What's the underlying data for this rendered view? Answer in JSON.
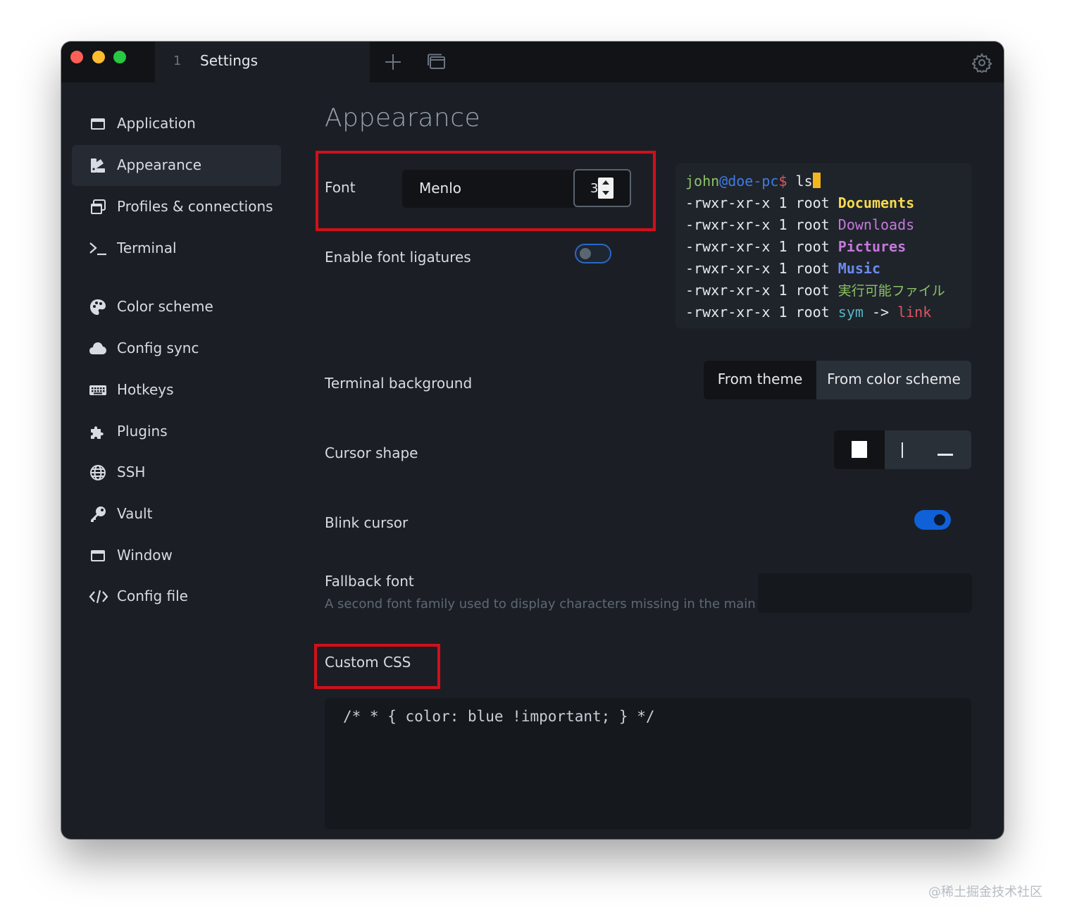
{
  "tab": {
    "number": "1",
    "title": "Settings"
  },
  "sidebar": {
    "items": [
      {
        "label": "Application",
        "icon": "application-icon"
      },
      {
        "label": "Appearance",
        "icon": "appearance-icon",
        "active": true
      },
      {
        "label": "Profiles & connections",
        "icon": "profiles-icon"
      },
      {
        "label": "Terminal",
        "icon": "terminal-icon"
      },
      {
        "label": "Color scheme",
        "icon": "palette-icon"
      },
      {
        "label": "Config sync",
        "icon": "cloud-icon"
      },
      {
        "label": "Hotkeys",
        "icon": "keyboard-icon"
      },
      {
        "label": "Plugins",
        "icon": "puzzle-icon"
      },
      {
        "label": "SSH",
        "icon": "globe-icon"
      },
      {
        "label": "Vault",
        "icon": "key-icon"
      },
      {
        "label": "Window",
        "icon": "window-icon"
      },
      {
        "label": "Config file",
        "icon": "code-icon"
      }
    ]
  },
  "main": {
    "title": "Appearance",
    "font": {
      "label": "Font",
      "value": "Menlo",
      "size": "3"
    },
    "ligatures": {
      "label": "Enable font ligatures",
      "enabled": false
    },
    "terminal_preview": {
      "prompt_user": "john",
      "prompt_at": "@",
      "prompt_host": "doe-pc",
      "prompt_symbol": "$",
      "command": " ls",
      "perm": "-rwxr-xr-x",
      "links": "1",
      "owner": "root",
      "files": [
        "Documents",
        "Downloads",
        "Pictures",
        "Music",
        "実行可能ファイル"
      ],
      "sym": "sym",
      "arrow": "->",
      "link": "link"
    },
    "terminal_background": {
      "label": "Terminal background",
      "options": [
        "From theme",
        "From color scheme"
      ],
      "selected": "From color scheme"
    },
    "cursor_shape": {
      "label": "Cursor shape",
      "options": [
        "block",
        "beam",
        "underline"
      ],
      "selected": "block"
    },
    "blink_cursor": {
      "label": "Blink cursor",
      "enabled": true
    },
    "fallback_font": {
      "label": "Fallback font",
      "hint": "A second font family used to display characters missing in the main font",
      "value": ""
    },
    "custom_css": {
      "label": "Custom CSS",
      "value": "/* * { color: blue !important; } */"
    }
  },
  "colors": {
    "accent": "#1060d8",
    "highlight": "#d20f1b",
    "prompt_user": "#8cc265",
    "prompt_host": "#3f7be0",
    "prompt_symbol": "#e05561",
    "file_documents": "#f7d94c",
    "file_downloads": "#c678dd",
    "file_pictures": "#c678dd",
    "file_music": "#6b8cf0",
    "file_exec": "#8cc265",
    "sym": "#56b6c2",
    "link": "#e05561"
  },
  "watermark": "@稀土掘金技术社区"
}
